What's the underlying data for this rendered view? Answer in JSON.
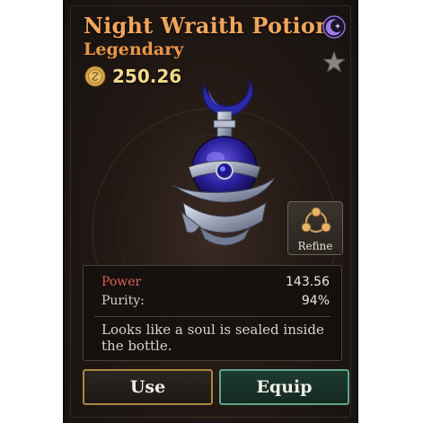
{
  "item": {
    "name": "Night Wraith Potion",
    "rarity": "Legendary",
    "price": "250.26",
    "icons": {
      "category": "crescent-moon-icon",
      "favorite": "star-icon",
      "currency": "coin-icon",
      "refine": "refine-icon"
    }
  },
  "actions": {
    "refine_label": "Refine",
    "use_label": "Use",
    "equip_label": "Equip"
  },
  "stats": [
    {
      "label": "Power",
      "value": "143.56"
    },
    {
      "label": "Purity:",
      "value": "94%"
    }
  ],
  "description": "Looks like a soul is sealed inside the bottle.",
  "colors": {
    "title": "#f0a55c",
    "rarity": "#e89648",
    "power_label": "#e0605a",
    "use_border": "#a8873f",
    "equip_border": "#5ea58a",
    "category_icon": "#8a6cd6"
  }
}
